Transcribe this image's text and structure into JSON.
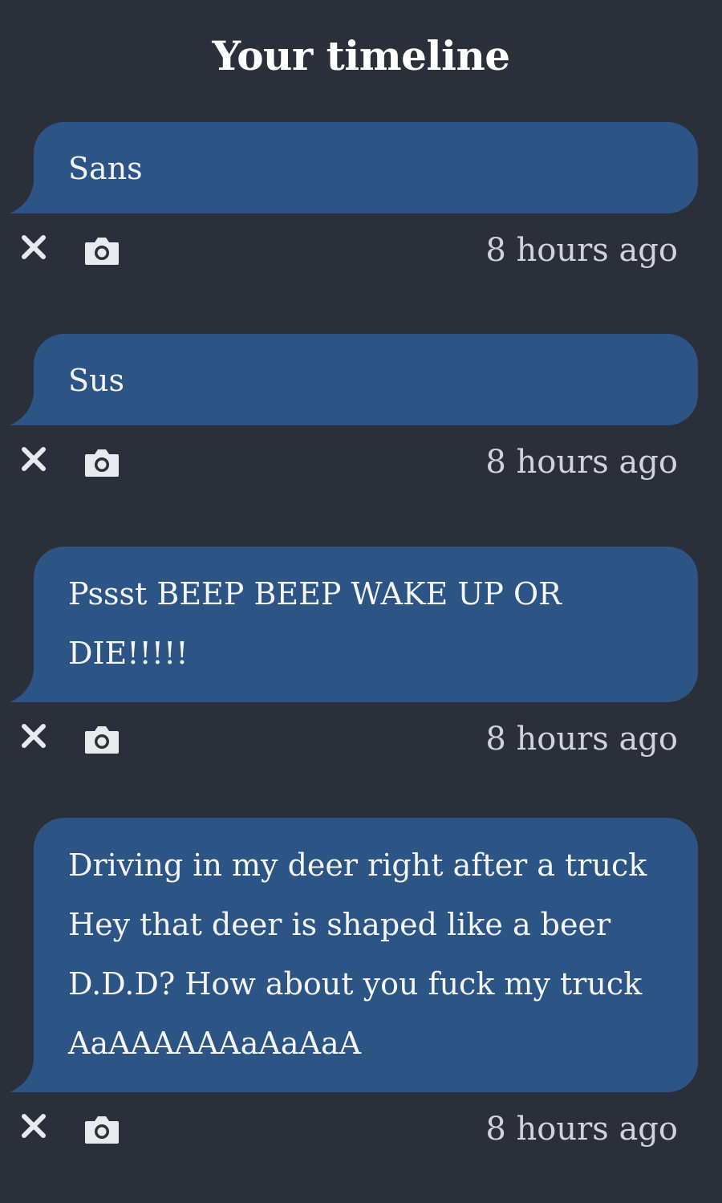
{
  "header": {
    "title": "Your timeline"
  },
  "posts": [
    {
      "lines": [
        "Sans"
      ],
      "timestamp": "8 hours ago"
    },
    {
      "lines": [
        "Sus"
      ],
      "timestamp": "8 hours ago"
    },
    {
      "lines": [
        "Pssst BEEP BEEP WAKE UP OR",
        "DIE!!!!!"
      ],
      "timestamp": "8 hours ago"
    },
    {
      "lines": [
        "Driving in my deer right after a truck",
        "Hey that deer is shaped like a beer",
        "D.D.D? How about you fuck my truck",
        "AaAAAAAAaAaAaA"
      ],
      "timestamp": "8 hours ago"
    }
  ],
  "icons": {
    "delete": "close-icon",
    "screenshot": "camera-icon"
  },
  "colors": {
    "background": "#2b2f3a",
    "bubble": "#2c5485",
    "text": "#ffffff",
    "timestamp": "#d0d3d9"
  }
}
